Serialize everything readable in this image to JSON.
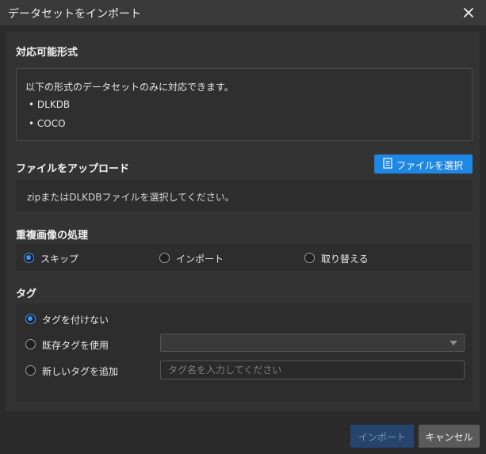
{
  "dialog": {
    "title": "データセットをインポート"
  },
  "formats": {
    "heading": "対応可能形式",
    "description": "以下の形式のデータセットのみに対応できます。",
    "items": [
      "• DLKDB",
      "• COCO"
    ]
  },
  "upload": {
    "heading": "ファイルをアップロード",
    "select_button": "ファイルを選択",
    "hint": "zipまたはDLKDBファイルを選択してください。"
  },
  "duplicates": {
    "heading": "重複画像の処理",
    "options": [
      {
        "label": "スキップ",
        "checked": true
      },
      {
        "label": "インポート",
        "checked": false
      },
      {
        "label": "取り替える",
        "checked": false
      }
    ]
  },
  "tags": {
    "heading": "タグ",
    "options": [
      {
        "label": "タグを付けない",
        "checked": true
      },
      {
        "label": "既存タグを使用",
        "checked": false
      },
      {
        "label": "新しいタグを追加",
        "checked": false
      }
    ],
    "existing_select_value": "",
    "new_tag_placeholder": "タグ名を入力してください",
    "new_tag_value": ""
  },
  "footer": {
    "import_button": "インポート",
    "cancel_button": "キャンセル"
  },
  "colors": {
    "accent": "#1e88e5",
    "radio_checked": "#3d95ff",
    "disabled_button": "#26456e"
  },
  "icons": {
    "close": "close-icon",
    "file": "file-icon",
    "dropdown": "chevron-down-icon"
  }
}
